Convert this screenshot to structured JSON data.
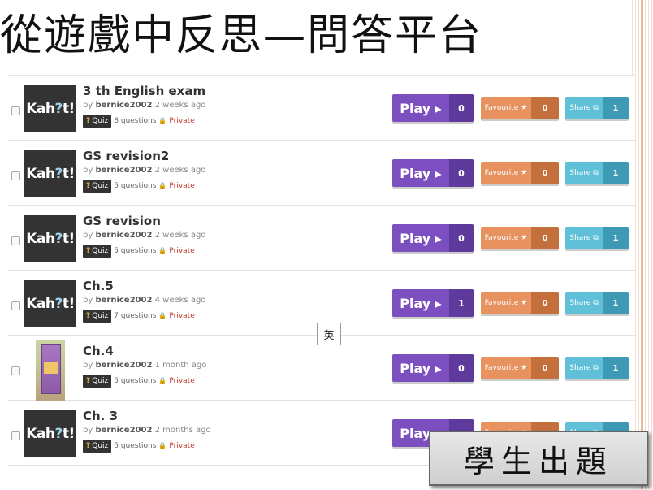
{
  "slide": {
    "title": "從遊戲中反思—問答平台",
    "callout": "學生出題",
    "ime_indicator": "英"
  },
  "buttons": {
    "play_label": "Play ▸",
    "favourite_label": "Favourite ★",
    "share_label": "Share ⧉"
  },
  "kahoots": [
    {
      "title": "3 th English exam",
      "by": "by",
      "author": "bernice2002",
      "age": "2 weeks ago",
      "badge": "Quiz",
      "questions": "8 questions",
      "visibility": "Private",
      "plays": "0",
      "favourites": "0",
      "shares": "1",
      "thumb": "kahoot-logo"
    },
    {
      "title": "GS revision2",
      "by": "by",
      "author": "bernice2002",
      "age": "2 weeks ago",
      "badge": "Quiz",
      "questions": "5 questions",
      "visibility": "Private",
      "plays": "0",
      "favourites": "0",
      "shares": "1",
      "thumb": "kahoot-logo"
    },
    {
      "title": "GS revision",
      "by": "by",
      "author": "bernice2002",
      "age": "2 weeks ago",
      "badge": "Quiz",
      "questions": "5 questions",
      "visibility": "Private",
      "plays": "0",
      "favourites": "0",
      "shares": "1",
      "thumb": "kahoot-logo"
    },
    {
      "title": "Ch.5",
      "by": "by",
      "author": "bernice2002",
      "age": "4 weeks ago",
      "badge": "Quiz",
      "questions": "7 questions",
      "visibility": "Private",
      "plays": "1",
      "favourites": "0",
      "shares": "1",
      "thumb": "kahoot-logo"
    },
    {
      "title": "Ch.4",
      "by": "by",
      "author": "bernice2002",
      "age": "1 month ago",
      "badge": "Quiz",
      "questions": "5 questions",
      "visibility": "Private",
      "plays": "0",
      "favourites": "0",
      "shares": "1",
      "thumb": "book-photo"
    },
    {
      "title": "Ch. 3",
      "by": "by",
      "author": "bernice2002",
      "age": "2 months ago",
      "badge": "Quiz",
      "questions": "5 questions",
      "visibility": "Private",
      "plays": "",
      "favourites": "",
      "shares": "",
      "thumb": "kahoot-logo"
    }
  ],
  "logo_text": {
    "pre": "Kah",
    "mid": "?",
    "post": "t!"
  },
  "colors": {
    "play": "#7c4fc1",
    "favourite": "#e8925f",
    "share": "#5fc0d8",
    "private": "#c0392b"
  }
}
